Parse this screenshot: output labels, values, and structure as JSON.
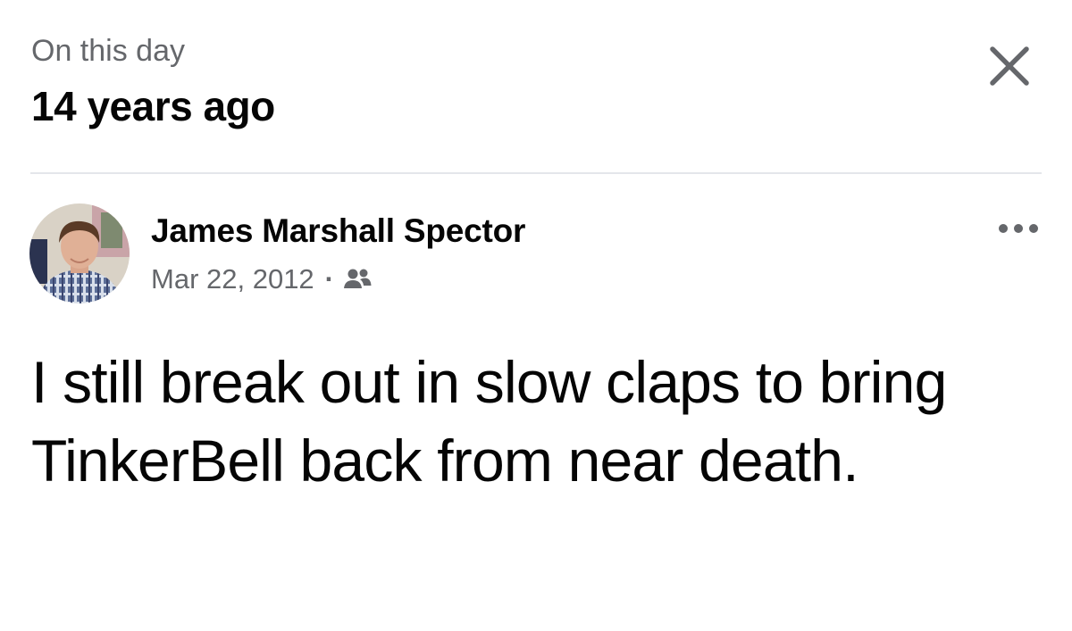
{
  "memory_header": {
    "kicker": "On this day",
    "title": "14 years ago"
  },
  "post": {
    "author_name": "James Marshall Spector",
    "date": "Mar 22, 2012",
    "separator": "·",
    "audience_icon": "friends-icon",
    "text": "I still break out in slow claps to bring TinkerBell back from near death."
  },
  "icons": {
    "close": "close-icon",
    "more": "more-options-icon"
  },
  "colors": {
    "primary_text": "#050505",
    "secondary_text": "#65676b",
    "divider": "#e4e6eb",
    "background": "#ffffff"
  }
}
